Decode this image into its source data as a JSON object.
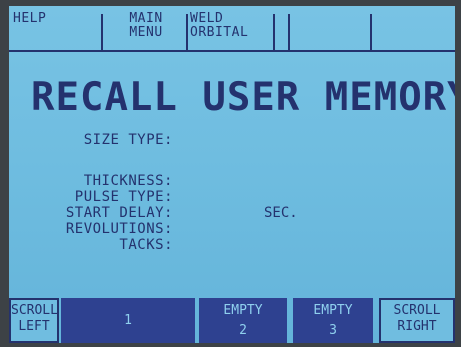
{
  "top_keys": [
    {
      "line1": "HELP",
      "line2": ""
    },
    {
      "line1": "MAIN",
      "line2": "MENU"
    },
    {
      "line1": "WELD",
      "line2": "ORBITAL"
    },
    {
      "line1": "",
      "line2": ""
    },
    {
      "line1": "",
      "line2": ""
    },
    {
      "line1": "",
      "line2": ""
    }
  ],
  "title": "RECALL USER MEMORY",
  "fields": {
    "size_type": "SIZE TYPE:",
    "thickness": "THICKNESS:",
    "pulse_type": "PULSE TYPE:",
    "start_delay": "START DELAY:",
    "start_delay_unit": "SEC.",
    "revolutions": "REVOLUTIONS:",
    "tacks": "TACKS:"
  },
  "bottom_keys": [
    {
      "line1": "SCROLL",
      "line2": "LEFT"
    },
    {
      "line1": "",
      "line2": "1"
    },
    {
      "line1": "EMPTY",
      "line2": "2"
    },
    {
      "line1": "EMPTY",
      "line2": "3"
    },
    {
      "line1": "SCROLL",
      "line2": "RIGHT"
    }
  ],
  "colors": {
    "screen_background": "#6fbde0",
    "text": "#24326e",
    "selected_key": "#2e4190"
  }
}
